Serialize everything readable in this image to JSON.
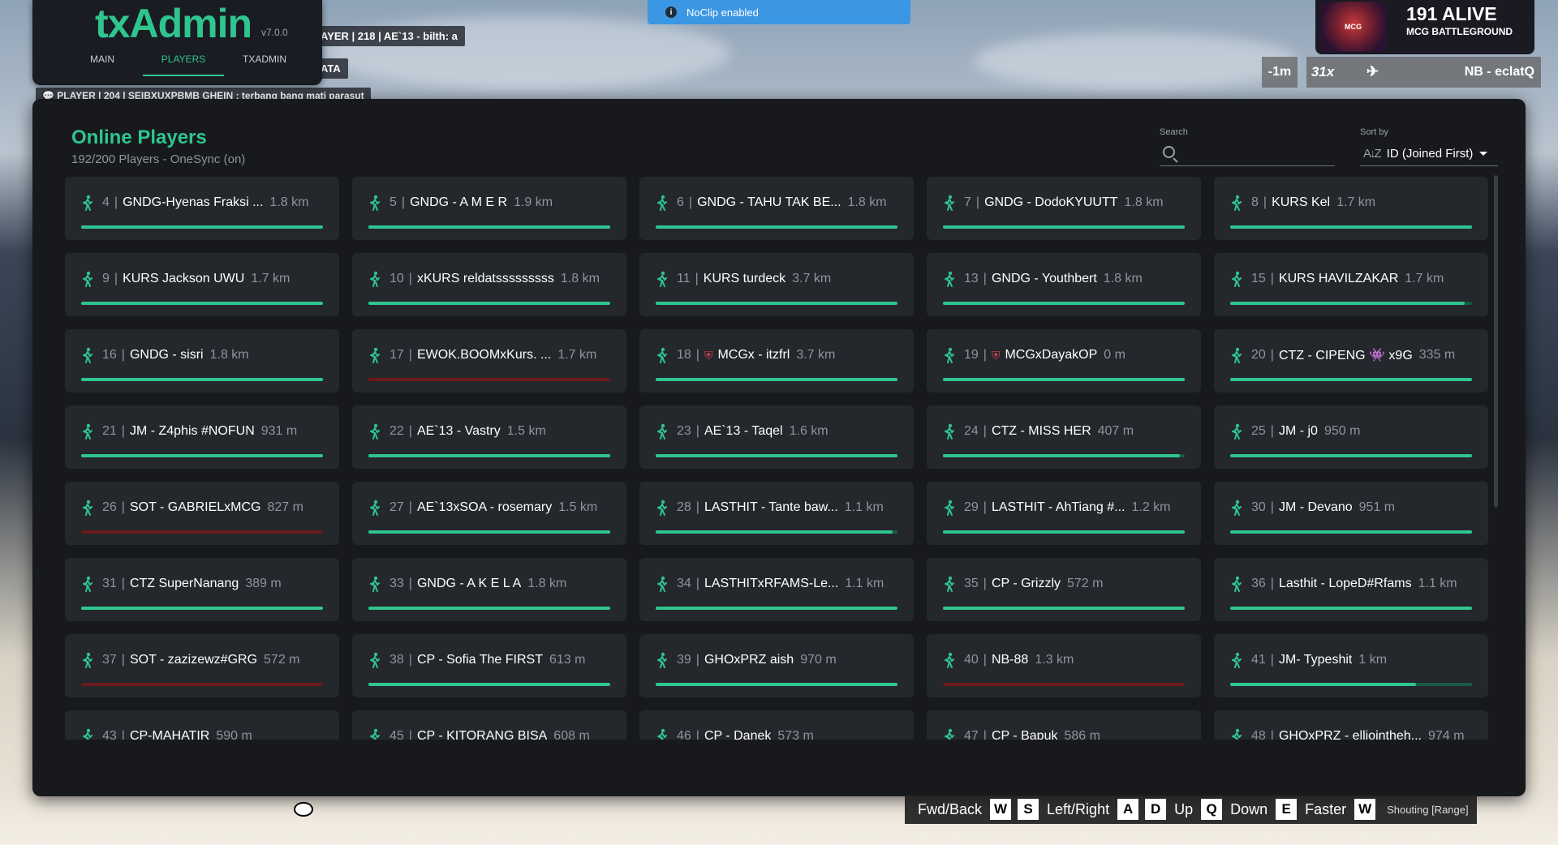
{
  "menu": {
    "logo": "txAdmin",
    "version": "v7.0.0",
    "tabs": [
      {
        "label": "MAIN",
        "active": false
      },
      {
        "label": "PLAYERS",
        "active": true
      },
      {
        "label": "TXADMIN",
        "active": false
      }
    ]
  },
  "killfeed": [
    "AYER | 218 | AE`13 - bilth: a",
    "ATA",
    "💬 PLAYER | 204 | SEIBXUXPBMB GHEIN : terbang bang mati parasut"
  ],
  "toast": {
    "icon": "info-icon",
    "text": "NoClip enabled"
  },
  "hud": {
    "alive": "191 ALIVE",
    "server": "MCG BATTLEGROUND",
    "logo_text": "MCG",
    "timer": "-1m",
    "multiplier": "31x",
    "crew": "NB - eclatQ"
  },
  "panel": {
    "title": "Online Players",
    "subtitle": "192/200 Players - OneSync (on)",
    "search": {
      "label": "Search",
      "placeholder": "",
      "value": ""
    },
    "sort": {
      "label": "Sort by",
      "icon": "sort-az-icon",
      "value": "ID (Joined First)"
    }
  },
  "players": [
    {
      "id": "4",
      "name": "GNDG-Hyenas Fraksi ...",
      "dist": "1.8 km",
      "health": 1.0,
      "flag": false
    },
    {
      "id": "5",
      "name": "GNDG - A M E R",
      "dist": "1.9 km",
      "health": 1.0,
      "flag": false
    },
    {
      "id": "6",
      "name": "GNDG - TAHU TAK BE...",
      "dist": "1.8 km",
      "health": 1.0,
      "flag": false
    },
    {
      "id": "7",
      "name": "GNDG - DodoKYUUTT",
      "dist": "1.8 km",
      "health": 1.0,
      "flag": false
    },
    {
      "id": "8",
      "name": "KURS Kel",
      "dist": "1.7 km",
      "health": 1.0,
      "flag": false
    },
    {
      "id": "9",
      "name": "KURS Jackson UWU",
      "dist": "1.7 km",
      "health": 1.0,
      "flag": false
    },
    {
      "id": "10",
      "name": "xKURS reldatsssssssss",
      "dist": "1.8 km",
      "health": 1.0,
      "flag": false
    },
    {
      "id": "11",
      "name": "KURS turdeck",
      "dist": "3.7 km",
      "health": 1.0,
      "flag": false
    },
    {
      "id": "13",
      "name": "GNDG - Youthbert",
      "dist": "1.8 km",
      "health": 1.0,
      "flag": false
    },
    {
      "id": "15",
      "name": "KURS HAVILZAKAR",
      "dist": "1.7 km",
      "health": 0.97,
      "flag": false
    },
    {
      "id": "16",
      "name": "GNDG - sisri",
      "dist": "1.8 km",
      "health": 1.0,
      "flag": false
    },
    {
      "id": "17",
      "name": "EWOK.BOOMxKurs. ...",
      "dist": "1.7 km",
      "health": 0,
      "flag": false
    },
    {
      "id": "18",
      "name": "MCGx - itzfrl",
      "dist": "3.7 km",
      "health": 1.0,
      "flag": true
    },
    {
      "id": "19",
      "name": "MCGxDayakOP",
      "dist": "0 m",
      "health": 1.0,
      "flag": true
    },
    {
      "id": "20",
      "name": "CTZ - CIPENG 👾 x9G",
      "dist": "335 m",
      "health": 1.0,
      "flag": false
    },
    {
      "id": "21",
      "name": "JM - Z4phis #NOFUN",
      "dist": "931 m",
      "health": 1.0,
      "flag": false
    },
    {
      "id": "22",
      "name": "AE`13 - Vastry",
      "dist": "1.5 km",
      "health": 1.0,
      "flag": false
    },
    {
      "id": "23",
      "name": "AE`13 - Taqel",
      "dist": "1.6 km",
      "health": 1.0,
      "flag": false
    },
    {
      "id": "24",
      "name": "CTZ - MISS HER",
      "dist": "407 m",
      "health": 0.98,
      "flag": false
    },
    {
      "id": "25",
      "name": "JM - j0",
      "dist": "950 m",
      "health": 1.0,
      "flag": false
    },
    {
      "id": "26",
      "name": "SOT - GABRIELxMCG",
      "dist": "827 m",
      "health": 0,
      "flag": false
    },
    {
      "id": "27",
      "name": "AE`13xSOA - rosemary",
      "dist": "1.5 km",
      "health": 1.0,
      "flag": false
    },
    {
      "id": "28",
      "name": "LASTHIT - Tante baw...",
      "dist": "1.1 km",
      "health": 0.98,
      "flag": false
    },
    {
      "id": "29",
      "name": "LASTHIT - AhTiang #...",
      "dist": "1.2 km",
      "health": 1.0,
      "flag": false
    },
    {
      "id": "30",
      "name": "JM - Devano",
      "dist": "951 m",
      "health": 1.0,
      "flag": false
    },
    {
      "id": "31",
      "name": "CTZ SuperNanang",
      "dist": "389 m",
      "health": 1.0,
      "flag": false
    },
    {
      "id": "33",
      "name": "GNDG - A K E L A",
      "dist": "1.8 km",
      "health": 1.0,
      "flag": false
    },
    {
      "id": "34",
      "name": "LASTHITxRFAMS-Le...",
      "dist": "1.1 km",
      "health": 1.0,
      "flag": false
    },
    {
      "id": "35",
      "name": "CP - Grizzly",
      "dist": "572 m",
      "health": 1.0,
      "flag": false
    },
    {
      "id": "36",
      "name": "Lasthit - LopeD#Rfams",
      "dist": "1.1 km",
      "health": 1.0,
      "flag": false
    },
    {
      "id": "37",
      "name": "SOT - zazizewz#GRG",
      "dist": "572 m",
      "health": 0,
      "flag": false
    },
    {
      "id": "38",
      "name": "CP - Sofia The FIRST",
      "dist": "613 m",
      "health": 1.0,
      "flag": false
    },
    {
      "id": "39",
      "name": "GHOxPRZ aish",
      "dist": "970 m",
      "health": 1.0,
      "flag": false
    },
    {
      "id": "40",
      "name": "NB-88",
      "dist": "1.3 km",
      "health": 0,
      "flag": false
    },
    {
      "id": "41",
      "name": "JM- Typeshit",
      "dist": "1 km",
      "health": 0.77,
      "flag": false
    },
    {
      "id": "43",
      "name": "CP-MAHATIR",
      "dist": "590 m",
      "health": 1.0,
      "flag": false
    },
    {
      "id": "45",
      "name": "CP - KITORANG BISA",
      "dist": "608 m",
      "health": 1.0,
      "flag": false
    },
    {
      "id": "46",
      "name": "CP - Danek",
      "dist": "573 m",
      "health": 1.0,
      "flag": false
    },
    {
      "id": "47",
      "name": "CP - Bapuk",
      "dist": "586 m",
      "health": 1.0,
      "flag": false
    },
    {
      "id": "48",
      "name": "GHOxPRZ - elliointheh...",
      "dist": "974 m",
      "health": 1.0,
      "flag": false
    }
  ],
  "keybinds": [
    {
      "label": "Fwd/Back",
      "keys": [
        "W",
        "S"
      ]
    },
    {
      "label": "Left/Right",
      "keys": [
        "A",
        "D"
      ]
    },
    {
      "label": "Up",
      "keys": [
        "Q"
      ]
    },
    {
      "label": "Down",
      "keys": [
        "E"
      ]
    },
    {
      "label": "Faster",
      "keys": [
        "W"
      ]
    }
  ],
  "voice": "Shouting [Range]",
  "colors": {
    "accent": "#2fc58f",
    "panel": "#17191d",
    "card": "#24272c",
    "dead": "#6b1a1a"
  }
}
